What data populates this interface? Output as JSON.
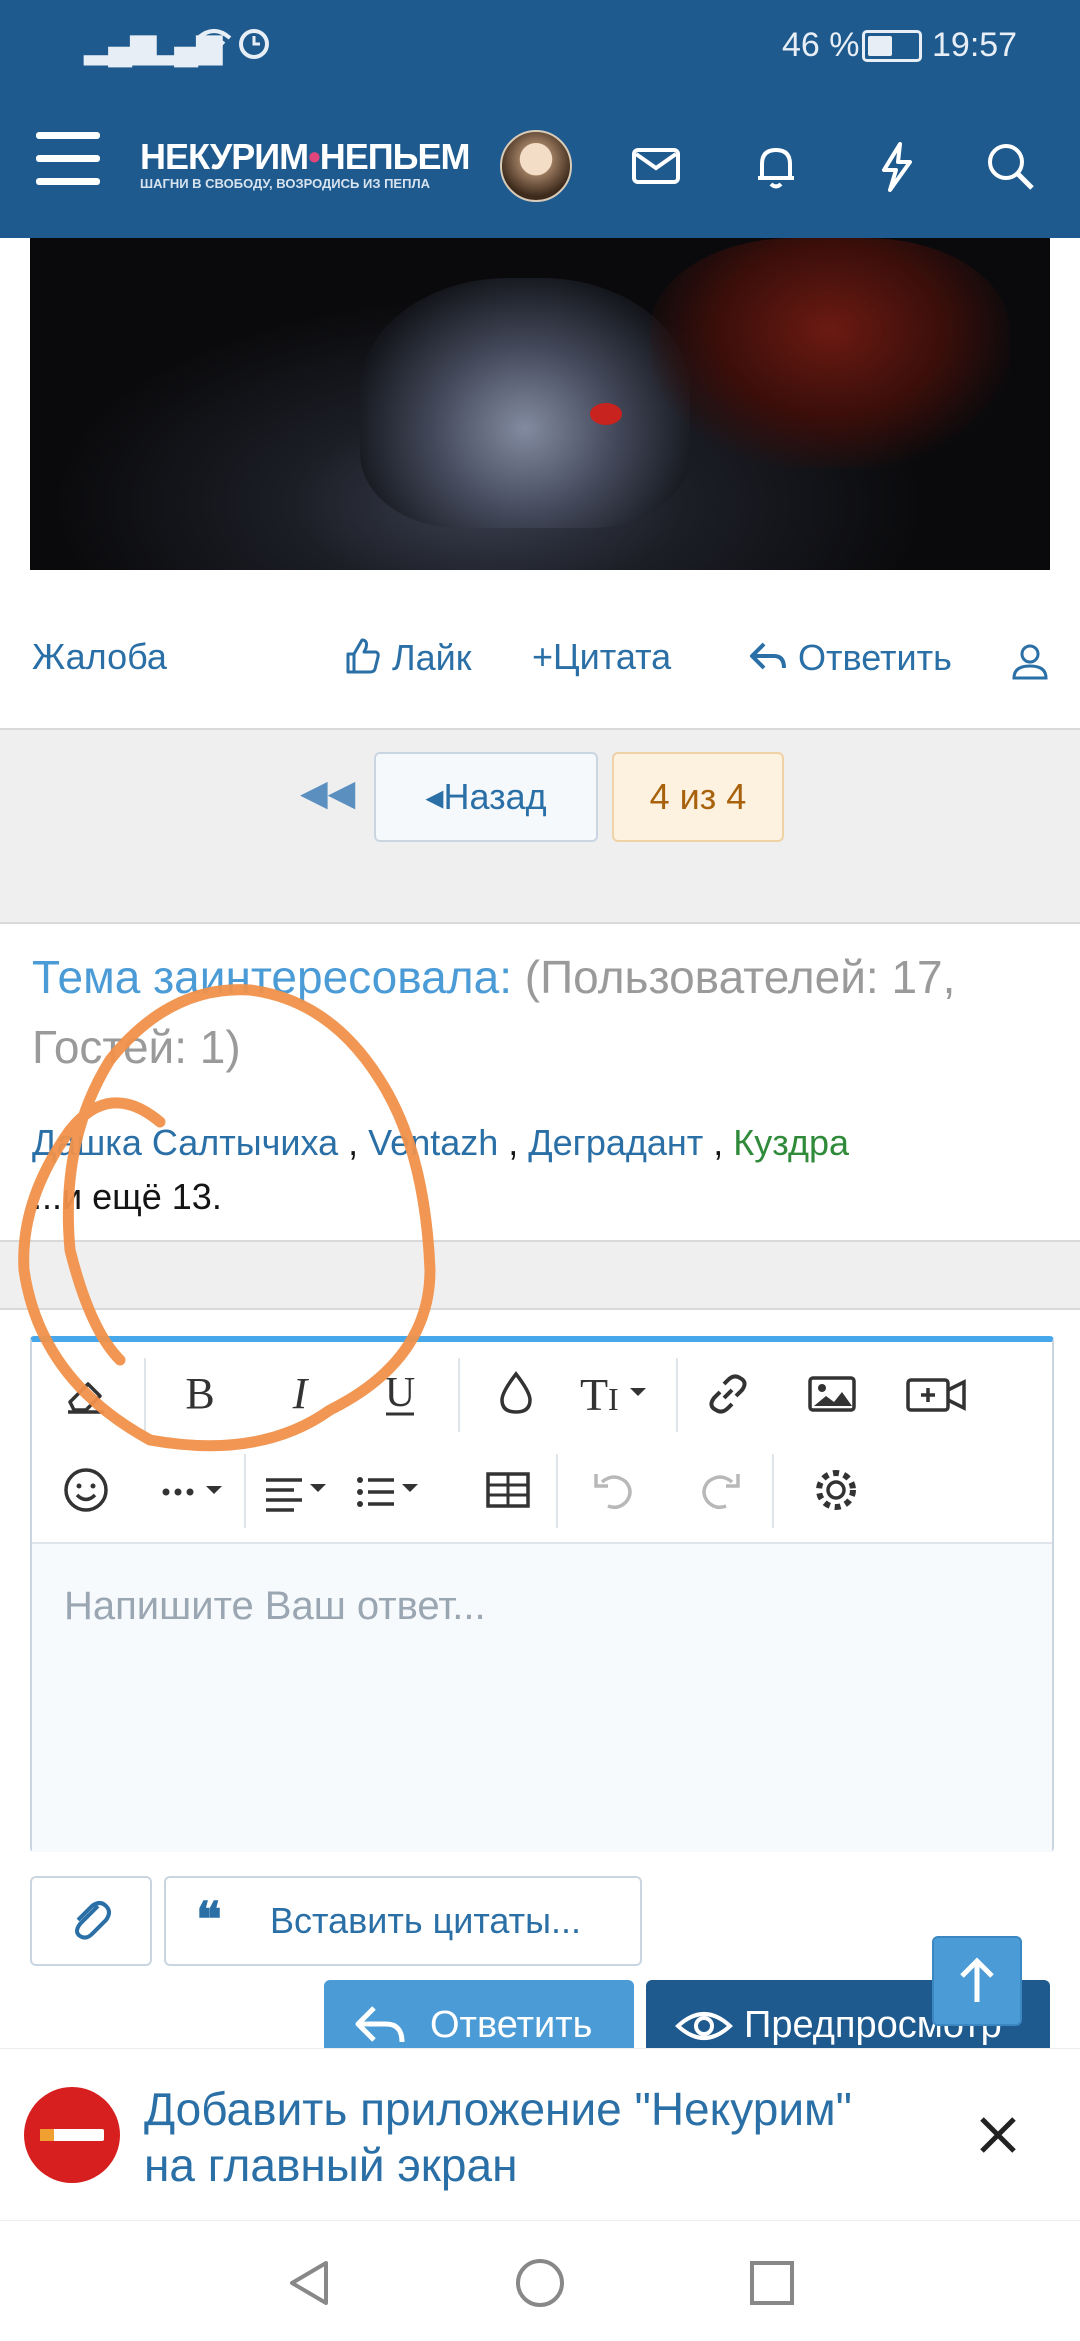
{
  "status_bar": {
    "battery": "46 %",
    "time": "19:57"
  },
  "header": {
    "logo_main": "НЕКУРИМ",
    "logo_dot": "•",
    "logo_main2": "НЕПЬЕМ",
    "logo_sub": "ШАГНИ В СВОБОДУ, ВОЗРОДИСЬ ИЗ ПЕПЛА"
  },
  "post_actions": {
    "report": "Жалоба",
    "like": "Лайк",
    "quote": "Цитата",
    "reply": "Ответить"
  },
  "pagination": {
    "back": "Назад",
    "current": "4 из 4"
  },
  "who_read": {
    "lead": "Тема заинтересовала:",
    "counts": "(Пользователей: 17, Гостей: 1)",
    "users": [
      "Дашка Салтычиха",
      "Ventazh",
      "Деградант",
      "Куздра"
    ],
    "more": "...и ещё 13."
  },
  "editor": {
    "placeholder": "Напишите Ваш ответ..."
  },
  "buttons": {
    "insert_quotes": "Вставить цитаты...",
    "reply": "Ответить",
    "preview": "Предпросмотр"
  },
  "banner": {
    "line1": "Добавить приложение \"Некурим\"",
    "line2": "на главный экран"
  },
  "colors": {
    "header": "#1e5a8e",
    "link": "#2a6fa6",
    "accent": "#4b9bd6",
    "annotation": "#f0914a"
  }
}
